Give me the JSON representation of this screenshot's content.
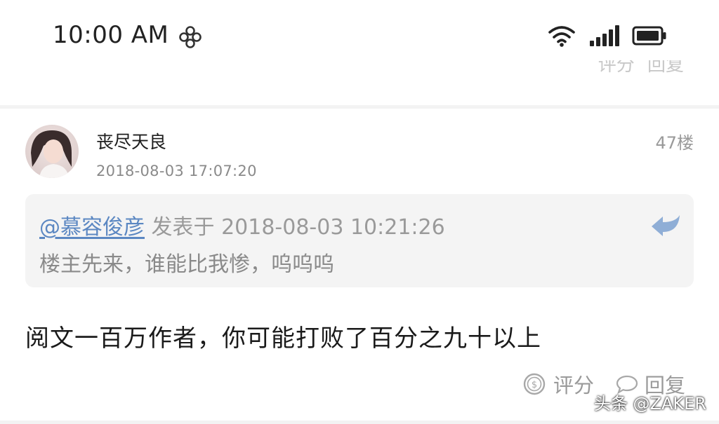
{
  "status_bar": {
    "time": "10:00 AM",
    "icons": [
      "carrier-icon",
      "wifi-icon",
      "signal-icon",
      "battery-icon"
    ]
  },
  "prev_post_actions": {
    "rate_label": "评分",
    "reply_label": "回复"
  },
  "post": {
    "username": "丧尽天良",
    "timestamp": "2018-08-03 17:07:20",
    "floor": "47楼",
    "quote": {
      "user": "@慕容俊彦",
      "meta": " 发表于 2018-08-03 10:21:26",
      "text": "楼主先来，谁能比我惨，呜呜呜"
    },
    "body": "阅文一百万作者，你可能打败了百分之九十以上",
    "actions": {
      "rate_label": "评分",
      "reply_label": "回复"
    }
  },
  "watermark": "头条 @ZAKER",
  "colors": {
    "link": "#5b87c2",
    "muted": "#9a9a9a",
    "quote_bg": "#f4f4f4"
  }
}
